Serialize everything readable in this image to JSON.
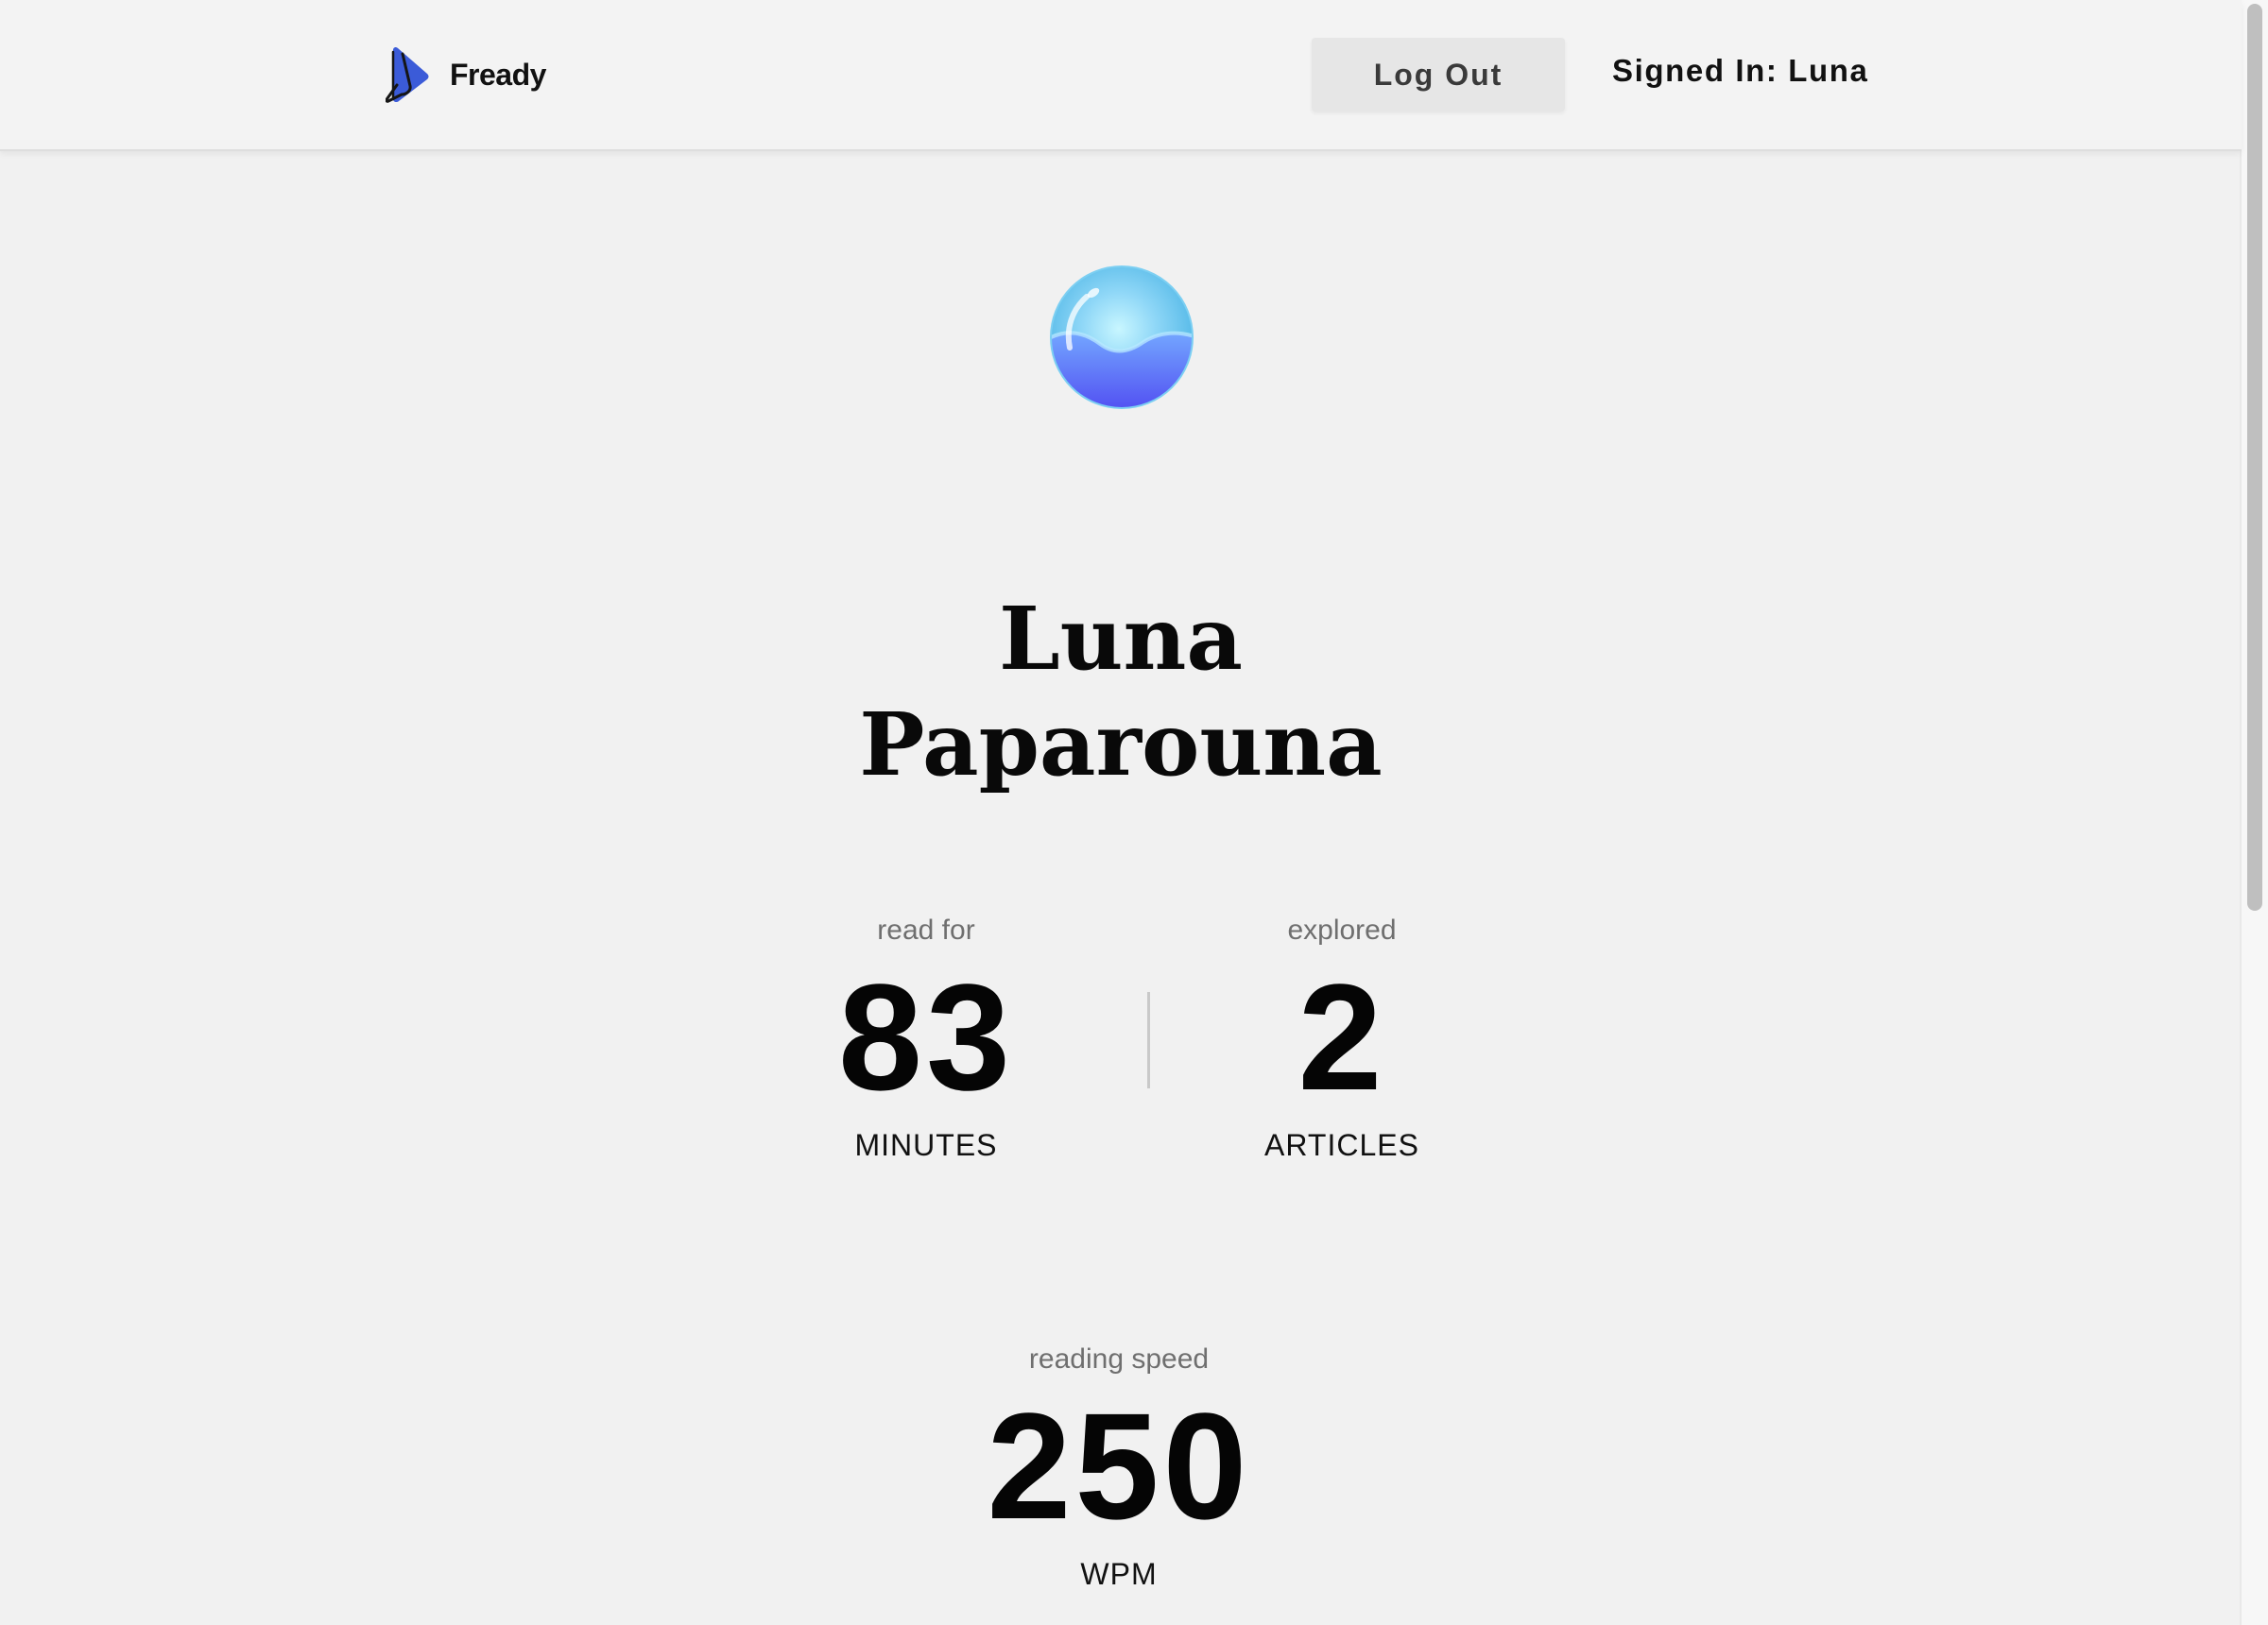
{
  "header": {
    "brand_name": "Fready",
    "brand_icon": "fready-play-logo-icon",
    "logout_label": "Log Out",
    "signed_in_text": "Signed In: Luna"
  },
  "profile": {
    "avatar_icon": "water-orb-avatar",
    "first_name": "Luna",
    "last_name": "Paparouna"
  },
  "stats": {
    "minutes": {
      "caption": "read for",
      "value": "83",
      "unit": "MINUTES"
    },
    "articles": {
      "caption": "explored",
      "value": "2",
      "unit": "ARTICLES"
    },
    "speed": {
      "caption": "reading speed",
      "value": "250",
      "unit": "WPM"
    }
  },
  "colors": {
    "page_background": "#f1f1f1",
    "brand_blue": "#3b5bd8",
    "avatar_top": "#8fd7f7",
    "avatar_bottom": "#5b5ef5",
    "button_background": "#e6e6e6",
    "muted_text": "#6f6f6f"
  }
}
